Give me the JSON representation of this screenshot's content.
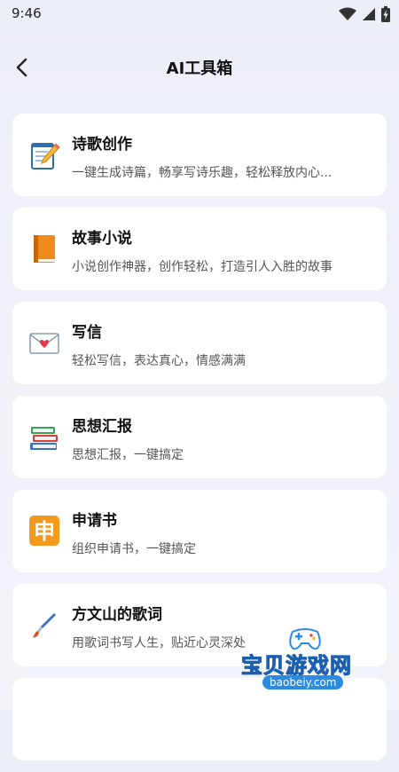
{
  "status_bar": {
    "time": "9:46"
  },
  "header": {
    "title": "AI工具箱"
  },
  "tools": [
    {
      "title": "诗歌创作",
      "desc": "一键生成诗篇，畅享写诗乐趣，轻松释放内心...",
      "icon": "memo-pencil-icon"
    },
    {
      "title": "故事小说",
      "desc": "小说创作神器，创作轻松，打造引人入胜的故事",
      "icon": "orange-book-icon"
    },
    {
      "title": "写信",
      "desc": "轻松写信，表达真心，情感满满",
      "icon": "love-letter-icon"
    },
    {
      "title": "思想汇报",
      "desc": "思想汇报，一键搞定",
      "icon": "books-stack-icon"
    },
    {
      "title": "申请书",
      "desc": "组织申请书，一键搞定",
      "icon": "shen-character-icon",
      "icon_char": "申"
    },
    {
      "title": "方文山的歌词",
      "desc": "用歌词书写人生，贴近心灵深处",
      "icon": "paintbrush-icon"
    }
  ],
  "watermark": {
    "text": "宝贝游戏网",
    "url": "baobeiy.com"
  }
}
